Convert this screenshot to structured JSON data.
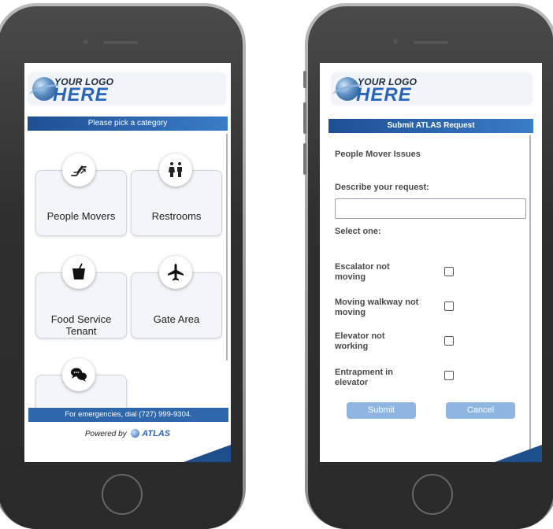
{
  "left_screen": {
    "logo": {
      "line1": "YOUR LOGO",
      "line2": "HERE"
    },
    "header": "Please pick a category",
    "tiles": [
      {
        "label": "People Movers",
        "icon": "escalator-icon"
      },
      {
        "label": "Restrooms",
        "icon": "restroom-icon"
      },
      {
        "label": "Food Service Tenant",
        "icon": "food-cup-icon"
      },
      {
        "label": "Gate Area",
        "icon": "airplane-icon"
      },
      {
        "label": "",
        "icon": "chat-bubbles-icon"
      }
    ],
    "footer": "For emergencies, dial (727) 999-9304.",
    "powered_by": "Powered by",
    "powered_logo": "ATLAS"
  },
  "right_screen": {
    "logo": {
      "line1": "YOUR LOGO",
      "line2": "HERE"
    },
    "header": "Submit ATLAS Request",
    "category": "People Mover Issues",
    "describe_label": "Describe your request:",
    "describe_value": "",
    "select_label": "Select one:",
    "options": [
      {
        "label": "Escalator not moving",
        "checked": false
      },
      {
        "label": "Moving walkway not moving",
        "checked": false
      },
      {
        "label": "Elevator not working",
        "checked": false
      },
      {
        "label": "Entrapment in elevator",
        "checked": false
      }
    ],
    "submit_label": "Submit",
    "cancel_label": "Cancel"
  },
  "colors": {
    "header_bar": "#2a64b8",
    "button": "#8fb6e3",
    "footer_bar": "#2f67ad"
  }
}
